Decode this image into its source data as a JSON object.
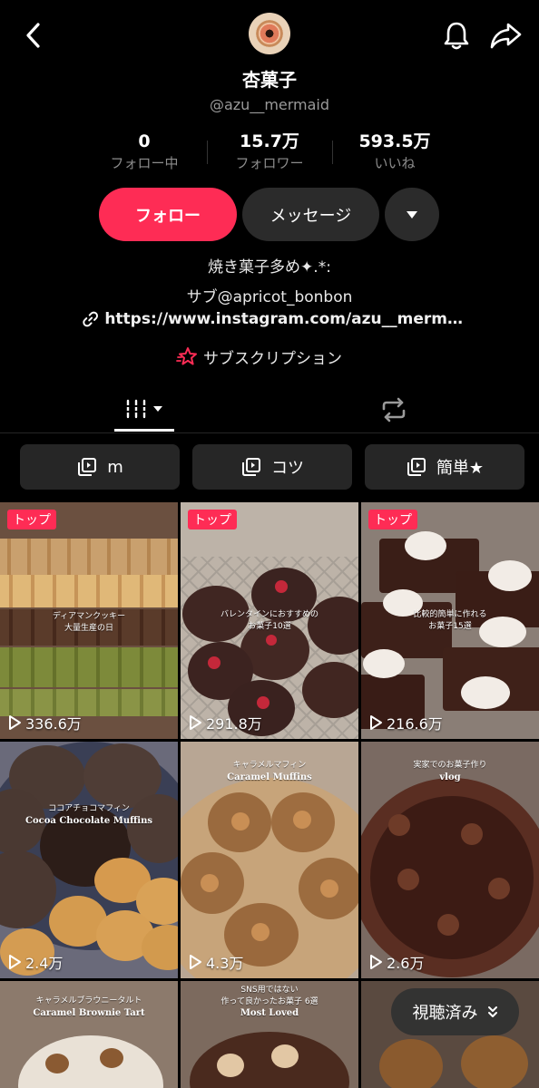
{
  "profile": {
    "name": "杏菓子",
    "handle": "@azu__mermaid"
  },
  "stats": [
    {
      "value": "0",
      "label": "フォロー中"
    },
    {
      "value": "15.7万",
      "label": "フォロワー"
    },
    {
      "value": "593.5万",
      "label": "いいね"
    }
  ],
  "actions": {
    "follow": "フォロー",
    "message": "メッセージ"
  },
  "bio": {
    "line1": "焼き菓子多め✦.*:",
    "line2": "サブ@apricot_bonbon",
    "link": "https://www.instagram.com/azu__merm…",
    "subscription": "サブスクリプション"
  },
  "playlists": [
    "m",
    "コツ",
    "簡単★"
  ],
  "videos": [
    {
      "badge": "トップ",
      "views": "336.6万",
      "caption": "ディアマンクッキー\n大量生産の日",
      "caption_en": ""
    },
    {
      "badge": "トップ",
      "views": "291.8万",
      "caption": "バレンタインにおすすめの\nお菓子10選",
      "caption_en": ""
    },
    {
      "badge": "トップ",
      "views": "216.6万",
      "caption": "比較的簡単に作れる\nお菓子15選",
      "caption_en": ""
    },
    {
      "badge": "",
      "views": "2.4万",
      "caption": "ココアチョコマフィン",
      "caption_en": "Cocoa Chocolate Muffins"
    },
    {
      "badge": "",
      "views": "4.3万",
      "caption": "キャラメルマフィン",
      "caption_en": "Caramel Muffins"
    },
    {
      "badge": "",
      "views": "2.6万",
      "caption": "実家でのお菓子作り",
      "caption_en": "vlog"
    },
    {
      "badge": "",
      "views": "",
      "caption": "キャラメルブラウニータルト",
      "caption_en": "Caramel Brownie Tart"
    },
    {
      "badge": "",
      "views": "",
      "caption": "SNS用ではない\n作って良かったお菓子 6選",
      "caption_en": "Most Loved"
    },
    {
      "badge": "",
      "views": "",
      "caption": "",
      "caption_en": ""
    }
  ],
  "watched_button": "視聴済み",
  "colors": {
    "accent": "#fe2c55",
    "background": "#000000",
    "chip": "#2b2b2b"
  }
}
